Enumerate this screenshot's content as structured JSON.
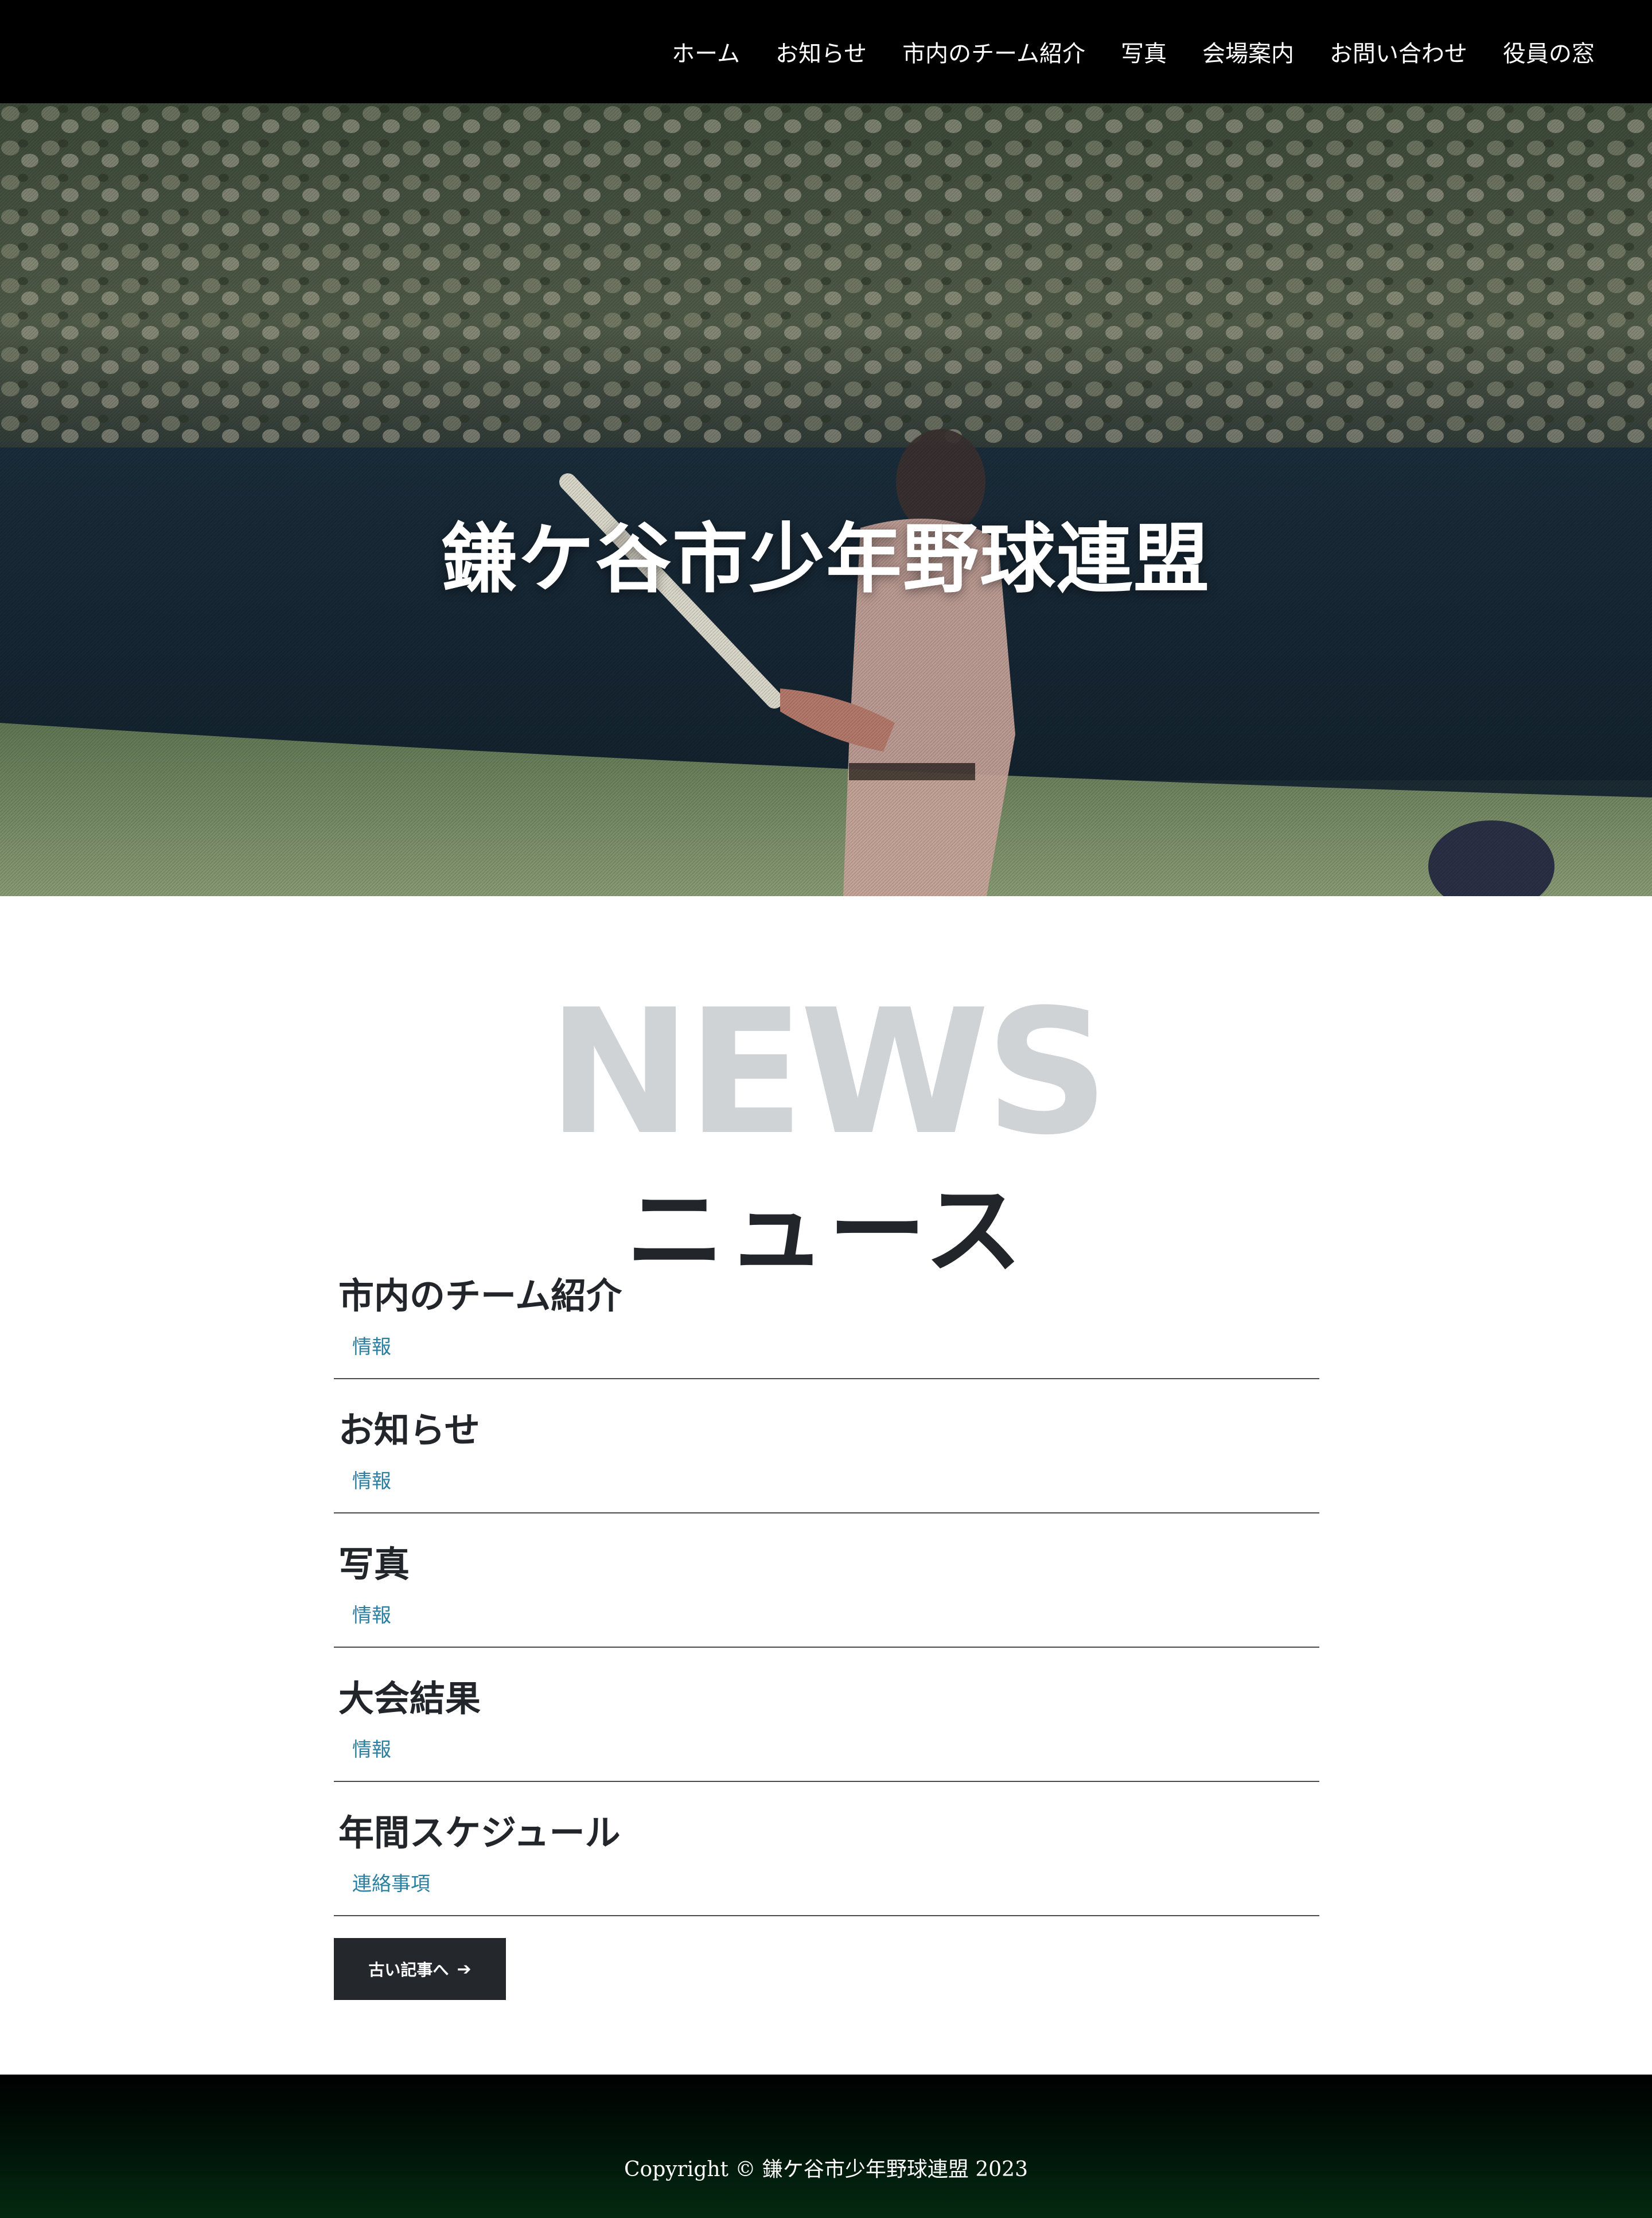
{
  "nav": {
    "items": [
      {
        "label": "ホーム"
      },
      {
        "label": "お知らせ"
      },
      {
        "label": "市内のチーム紹介"
      },
      {
        "label": "写真"
      },
      {
        "label": "会場案内"
      },
      {
        "label": "お問い合わせ"
      },
      {
        "label": "役員の窓"
      }
    ]
  },
  "hero": {
    "title": "鎌ケ谷市少年野球連盟"
  },
  "news": {
    "bg_heading": "NEWS",
    "heading": "ニュース",
    "posts": [
      {
        "title": "市内のチーム紹介",
        "category": "情報"
      },
      {
        "title": "お知らせ",
        "category": "情報"
      },
      {
        "title": "写真",
        "category": "情報"
      },
      {
        "title": "大会結果",
        "category": "情報"
      },
      {
        "title": "年間スケジュール",
        "category": "連絡事項"
      }
    ],
    "older_button_label": "古い記事へ",
    "older_button_icon": "arrow-right-icon"
  },
  "footer": {
    "copyright": "Copyright © 鎌ケ谷市少年野球連盟 2023"
  },
  "colors": {
    "nav_bg": "#000000",
    "link_accent": "#2b7fa0",
    "button_bg": "#24272c",
    "heading_ghost": "#cfd3d6"
  }
}
